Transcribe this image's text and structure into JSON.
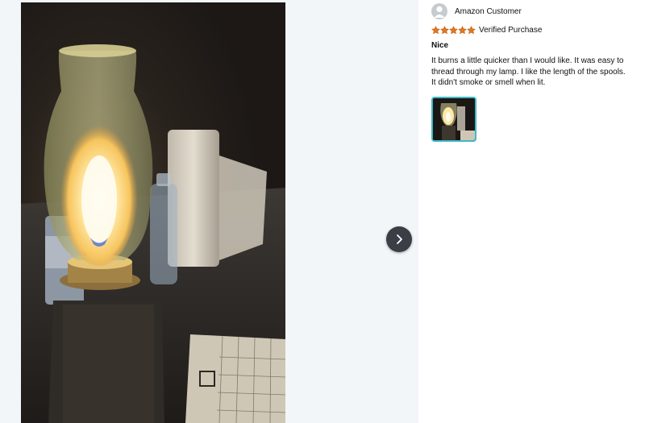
{
  "viewer": {
    "next_icon": "chevron-right-icon",
    "photo_description_icon": "review-photo"
  },
  "review": {
    "reviewer_name": "Amazon Customer",
    "avatar_icon": "user-avatar-icon",
    "rating": {
      "stars": 5,
      "max": 5,
      "star_color": "#de7921"
    },
    "verified_label": "Verified Purchase",
    "title": "Nice",
    "body": "It burns a little quicker than I would like. It was easy to thread through my lamp. I like the length of the spools. It didn't smoke or smell when lit.",
    "thumbnail_selected_color": "#3fb8c7"
  }
}
